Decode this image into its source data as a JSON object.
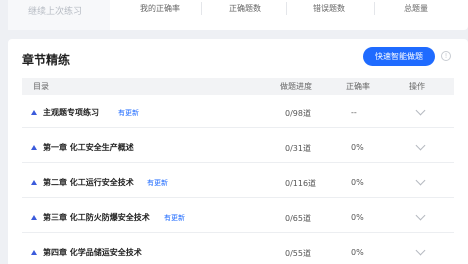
{
  "top": {
    "continue_label": "继续上次练习",
    "stats": [
      "我的正确率",
      "正确题数",
      "错误题数",
      "总题量"
    ]
  },
  "section": {
    "title": "章节精练",
    "quick_button": "快速智能做题",
    "help_icon": "info-circle-icon"
  },
  "table": {
    "headers": {
      "catalog": "目录",
      "progress": "做题进度",
      "accuracy": "正确率",
      "action": "操作"
    },
    "rows": [
      {
        "title": "主观题专项练习",
        "badge": "有更新",
        "progress": "0/98道",
        "accuracy": "--"
      },
      {
        "title": "第一章 化工安全生产概述",
        "badge": "",
        "progress": "0/31道",
        "accuracy": "0%"
      },
      {
        "title": "第二章 化工运行安全技术",
        "badge": "有更新",
        "progress": "0/116道",
        "accuracy": "0%"
      },
      {
        "title": "第三章 化工防火防爆安全技术",
        "badge": "有更新",
        "progress": "0/65道",
        "accuracy": "0%"
      },
      {
        "title": "第四章 化学品储运安全技术",
        "badge": "",
        "progress": "0/55道",
        "accuracy": "0%"
      }
    ]
  },
  "colors": {
    "accent": "#1f6bff",
    "expand_triangle": "#3b5bdb"
  }
}
